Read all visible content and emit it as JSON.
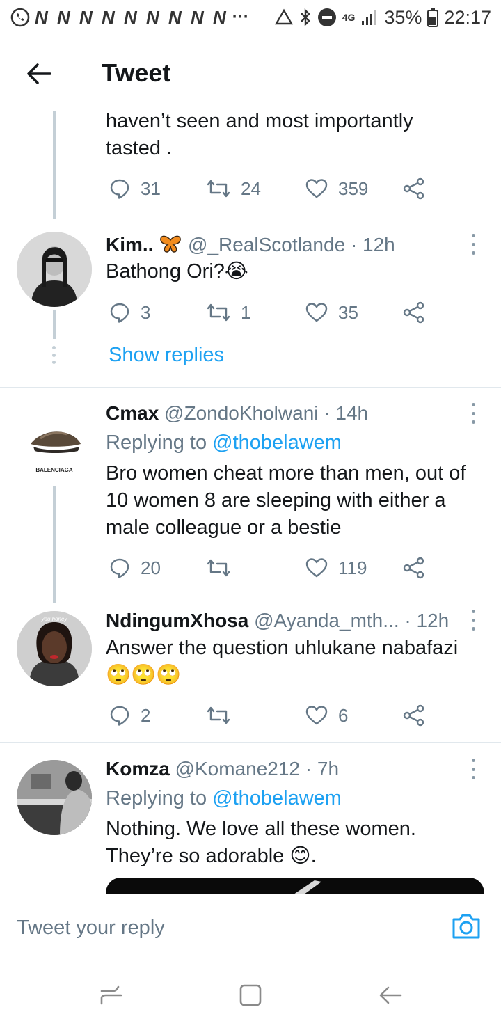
{
  "status_bar": {
    "n_icons": "N N N N N N N N N",
    "more": "···",
    "network": "4G",
    "battery": "35%",
    "time": "22:17"
  },
  "header": {
    "title": "Tweet"
  },
  "top_tweet": {
    "text_line1": "haven’t  seen and most importantly",
    "text_line2": "tasted .",
    "replies": "31",
    "retweets": "24",
    "likes": "359"
  },
  "tweets": [
    {
      "name": "Kim..",
      "handle": "@_RealScotlande",
      "time": "· 12h",
      "text": "Bathong Ori?😭",
      "replies": "3",
      "retweets": "1",
      "likes": "35"
    },
    {
      "name": "Cmax",
      "handle": "@ZondoKholwani",
      "time": "· 14h",
      "replying_prefix": "Replying to",
      "replying_to": "@thobelawem",
      "text_line1": "Bro women cheat more than men, out of",
      "text_line2": "10 women 8 are sleeping with either a",
      "text_line3": "male colleague or a bestie",
      "avatar_label": "BALENCIAGA",
      "replies": "20",
      "retweets": "",
      "likes": "119"
    },
    {
      "name": "NdingumXhosa",
      "handle": "@Ayanda_mth...",
      "time": "· 12h",
      "text_line1": "Answer the question uhlukane nabafazi",
      "text_line2": "🙄🙄🙄",
      "avatar_label": "you honey",
      "replies": "2",
      "retweets": "",
      "likes": "6"
    },
    {
      "name": "Komza",
      "handle": "@Komane212",
      "time": "· 7h",
      "replying_prefix": "Replying to",
      "replying_to": "@thobelawem",
      "text_line1": "Nothing. We love all these women.",
      "text_line2": "They’re so adorable 😊."
    }
  ],
  "show_replies": "Show replies",
  "reply_bar": {
    "placeholder": "Tweet your reply"
  },
  "colors": {
    "accent": "#1da1f2",
    "muted": "#657786",
    "text": "#14171a",
    "divider": "#e1e8ed"
  }
}
